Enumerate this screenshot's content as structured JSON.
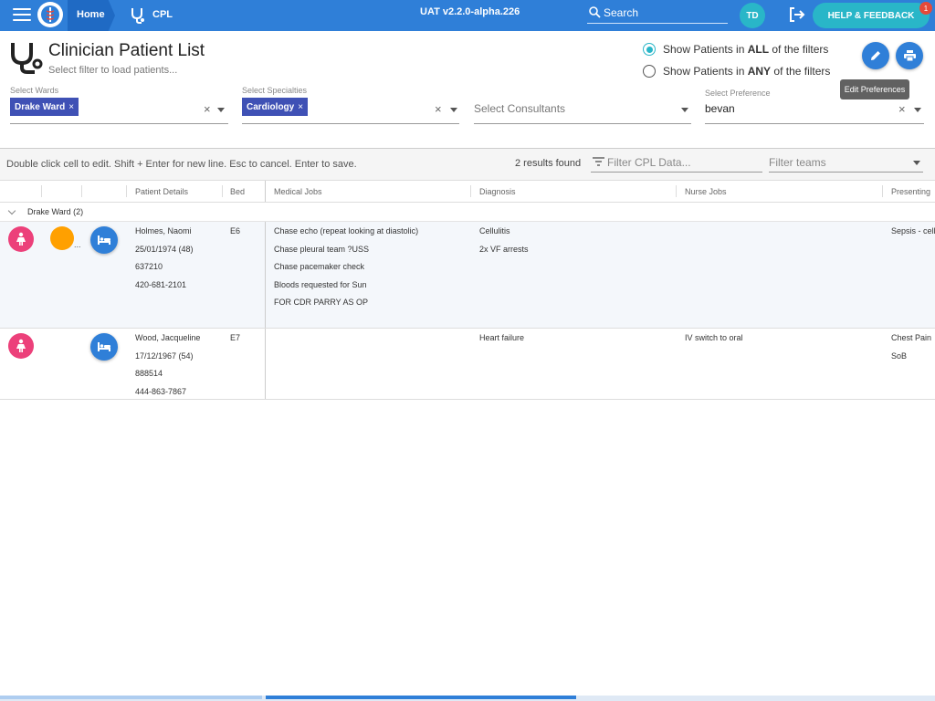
{
  "topbar": {
    "home": "Home",
    "app": "CPL",
    "version": "UAT v2.2.0-alpha.226",
    "search": "Search",
    "avatar": "TD",
    "help": "HELP & FEEDBACK",
    "help_badge": "1"
  },
  "header": {
    "title": "Clinician Patient List",
    "subtitle": "Select filter to load patients...",
    "radio_all": {
      "pre": "Show Patients in ",
      "bold": "ALL",
      "post": " of the filters",
      "selected": true
    },
    "radio_any": {
      "pre": "Show Patients in ",
      "bold": "ANY",
      "post": " of the filters",
      "selected": false
    },
    "tooltip": "Edit Preferences"
  },
  "filters": {
    "wards_label": "Select Wards",
    "wards_chip": "Drake Ward",
    "specialties_label": "Select Specialties",
    "specialties_chip": "Cardiology",
    "consultants_placeholder": "Select Consultants",
    "preference_label": "Select Preference",
    "preference_value": "bevan",
    "chip_remove": "×",
    "clear": "×"
  },
  "toolbar": {
    "hint": "Double click cell to edit. Shift + Enter for new line. Esc to cancel. Enter to save.",
    "count": "2 results found",
    "filter_cpl_placeholder": "Filter CPL Data...",
    "filter_teams_placeholder": "Filter teams"
  },
  "grid": {
    "columns": {
      "patient": "Patient Details",
      "bed": "Bed",
      "medical": "Medical Jobs",
      "diagnosis": "Diagnosis",
      "nurse": "Nurse Jobs",
      "presenting": "Presenting"
    },
    "group": "Drake Ward (2)",
    "rows": [
      {
        "details": [
          "Holmes, Naomi",
          "25/01/1974 (48)",
          "637210",
          "420-681-2101"
        ],
        "bed": "E6",
        "medical": [
          "Chase echo (repeat looking at diastolic)",
          "Chase pleural team ?USS",
          "Chase pacemaker check",
          "Bloods requested for Sun",
          "FOR CDR PARRY AS OP"
        ],
        "diagnosis": [
          "Cellulitis",
          "2x VF arrests"
        ],
        "nurse": [],
        "presenting": [
          "Sepsis - cell"
        ],
        "flag_more": "..."
      },
      {
        "details": [
          "Wood, Jacqueline",
          "17/12/1967 (54)",
          "888514",
          "444-863-7867"
        ],
        "bed": "E7",
        "medical": [],
        "diagnosis": [
          "Heart failure"
        ],
        "nurse": [
          "IV switch to oral"
        ],
        "presenting": [
          "Chest Pain",
          "SoB"
        ]
      }
    ]
  }
}
